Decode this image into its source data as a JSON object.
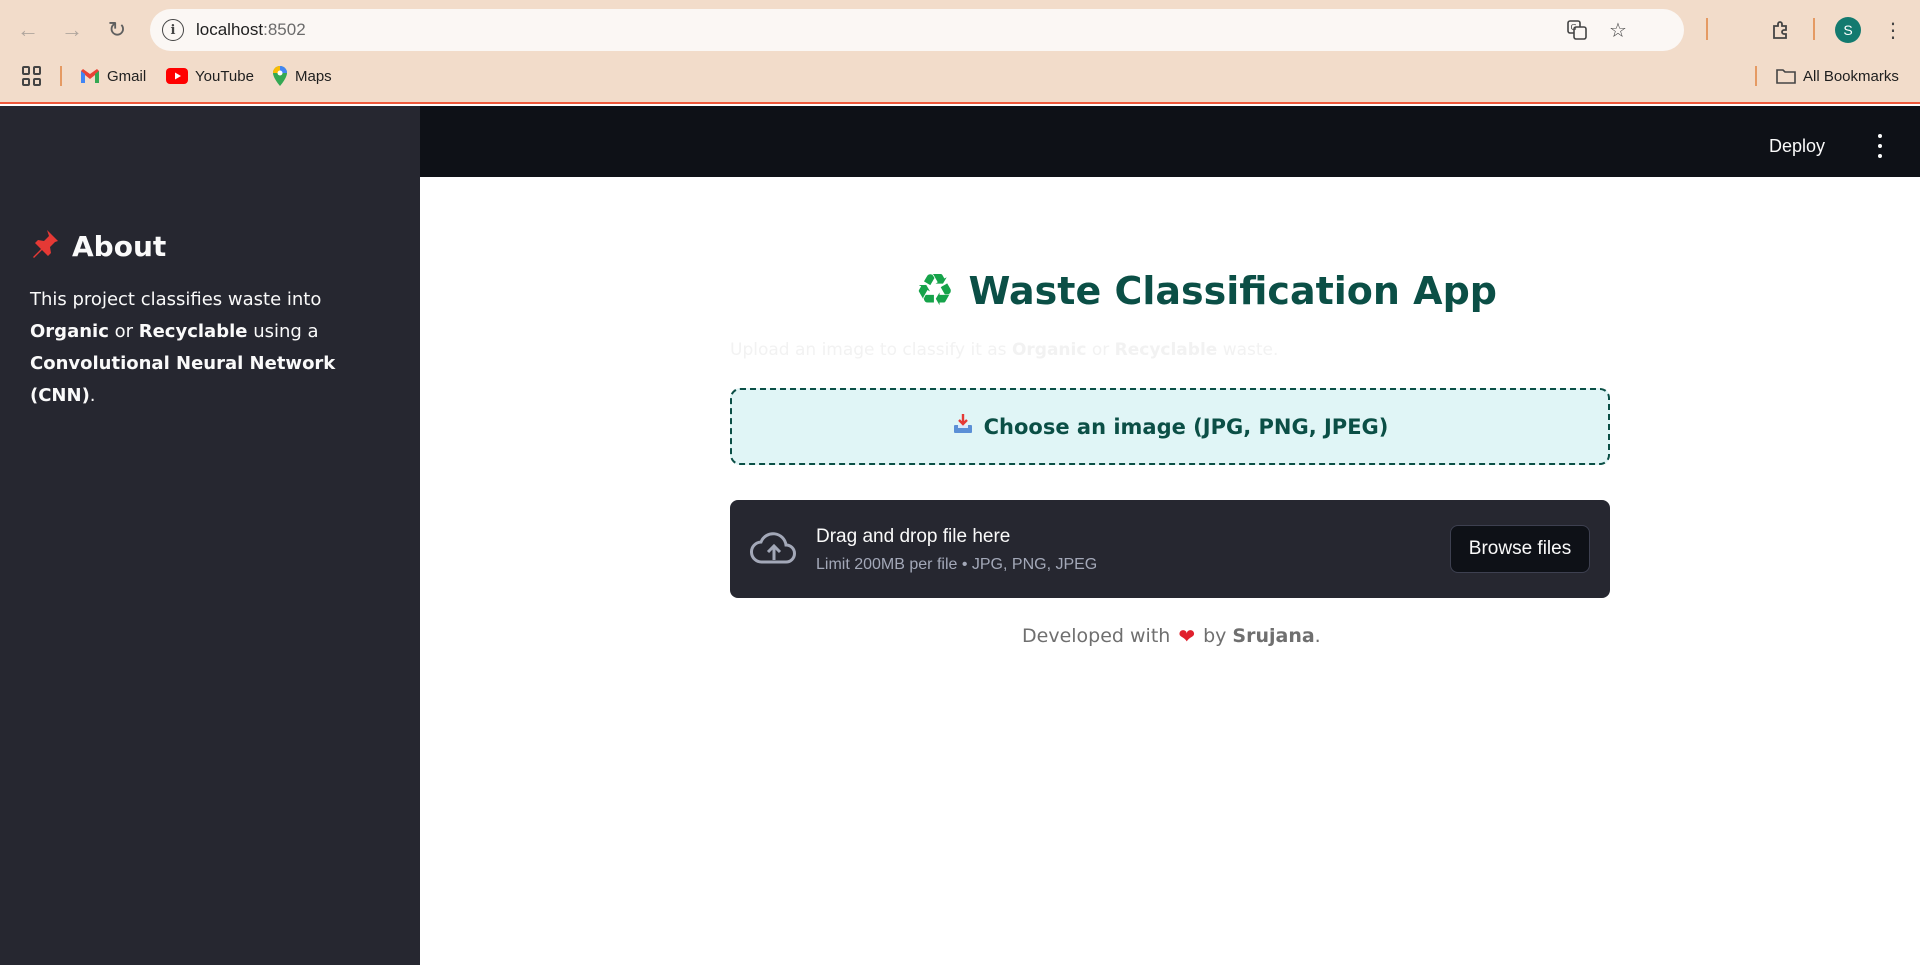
{
  "browser": {
    "url_host": "localhost",
    "url_port": ":8502",
    "bookmarks": [
      {
        "label": "Gmail",
        "icon": "gmail-icon"
      },
      {
        "label": "YouTube",
        "icon": "youtube-icon"
      },
      {
        "label": "Maps",
        "icon": "maps-icon"
      }
    ],
    "all_bookmarks_label": "All Bookmarks",
    "profile_initial": "S"
  },
  "sidebar": {
    "title": "About",
    "title_icon": "pushpin-icon",
    "text_1": "This project classifies waste into ",
    "bold_1": "Organic",
    "text_2": " or ",
    "bold_2": "Recyclable",
    "text_3": " using a ",
    "bold_3": "Convolutional Neural Network (CNN)",
    "text_4": "."
  },
  "header": {
    "deploy_label": "Deploy"
  },
  "main": {
    "title": "Waste Classification App",
    "title_icon": "recycle-icon",
    "subtitle_1": "Upload an image to classify it as ",
    "subtitle_bold_1": "Organic",
    "subtitle_2": " or ",
    "subtitle_bold_2": "Recyclable",
    "subtitle_3": " waste.",
    "choose_label": "Choose an image (JPG, PNG, JPEG)",
    "choose_icon": "inbox-tray-icon",
    "dropzone_title": "Drag and drop file here",
    "dropzone_limit": "Limit 200MB per file • JPG, PNG, JPEG",
    "browse_label": "Browse files",
    "footer_prefix": "Developed with",
    "footer_by": "by",
    "footer_name": "Srujana",
    "footer_suffix": "."
  },
  "colors": {
    "accent": "#0b4f46",
    "sidebar_bg": "#262730",
    "header_bg": "#0e1117",
    "choose_bg": "#e0f5f6",
    "browser_bg": "#f2dcca"
  }
}
